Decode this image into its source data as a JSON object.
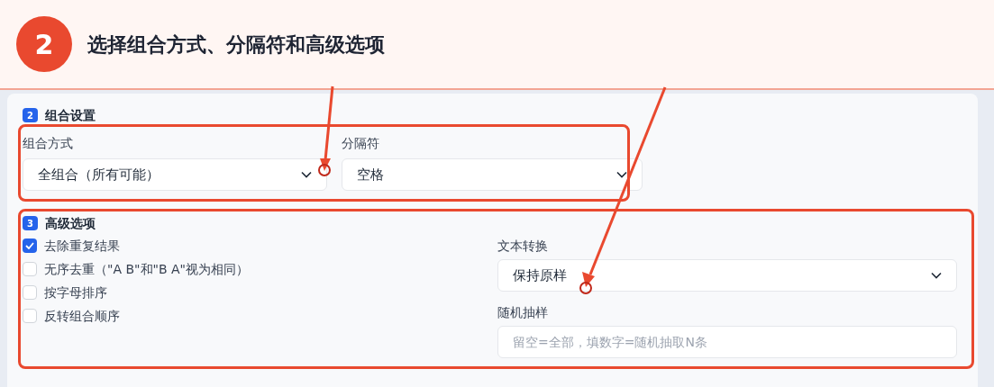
{
  "banner": {
    "step": "2",
    "title": "选择组合方式、分隔符和高级选项"
  },
  "combo_section": {
    "badge": "2",
    "title": "组合设置",
    "fields": [
      {
        "label": "组合方式",
        "value": "全组合（所有可能）"
      },
      {
        "label": "分隔符",
        "value": "空格"
      }
    ]
  },
  "advanced_section": {
    "badge": "3",
    "title": "高级选项",
    "options": [
      {
        "label": "去除重复结果",
        "checked": true
      },
      {
        "label": "无序去重（\"A B\"和\"B A\"视为相同）",
        "checked": false
      },
      {
        "label": "按字母排序",
        "checked": false
      },
      {
        "label": "反转组合顺序",
        "checked": false
      }
    ],
    "text_transform": {
      "label": "文本转换",
      "value": "保持原样"
    },
    "random_sample": {
      "label": "随机抽样",
      "placeholder": "留空=全部，填数字=随机抽取N条"
    }
  }
}
